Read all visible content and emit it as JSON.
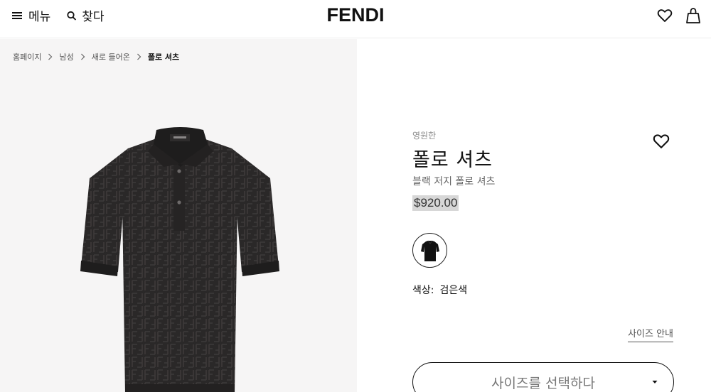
{
  "header": {
    "menu_label": "메뉴",
    "search_label": "찾다",
    "logo": "FENDI"
  },
  "breadcrumb": [
    "홈페이지",
    "남성",
    "새로 들어온",
    "폴로 셔츠"
  ],
  "product": {
    "eyebrow": "영원한",
    "title": "폴로 셔츠",
    "subtitle": "블랙 저지 폴로 셔츠",
    "price": "$920.00",
    "color_label": "색상:",
    "color_value": "검은색",
    "size_guide": "사이즈 안내",
    "size_select": "사이즈를 선택하다"
  },
  "colors": {
    "panel_bg": "#f6f5f5",
    "shirt": "#2a2828",
    "price_highlight": "#d7d7d7"
  }
}
